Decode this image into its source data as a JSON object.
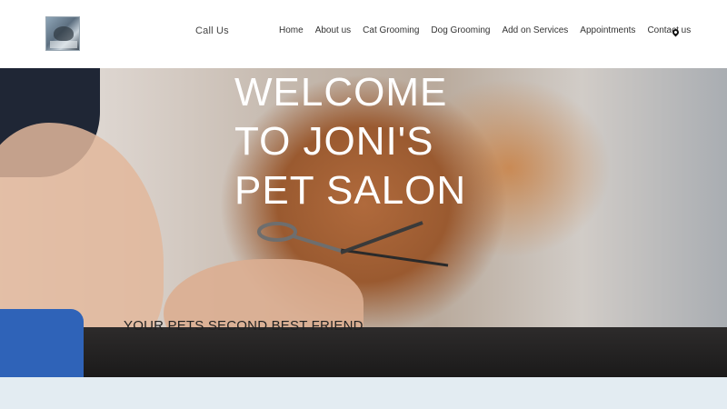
{
  "header": {
    "logo_icon": "pet-salon-logo",
    "call_label": "Call Us",
    "nav": [
      "Home",
      "About us",
      "Cat Grooming",
      "Dog Grooming",
      "Add on Services",
      "Appointments",
      "Contact us"
    ],
    "map_icon": "map-pin-icon"
  },
  "hero": {
    "title_lines": [
      "WELCOME",
      "TO JONI'S",
      "PET SALON"
    ],
    "subtitle": "YOUR PETS SECOND BEST FRIEND"
  },
  "colors": {
    "title_text": "#ffffff",
    "bottom_band": "#e3ecf2",
    "nav_text": "#333333"
  }
}
